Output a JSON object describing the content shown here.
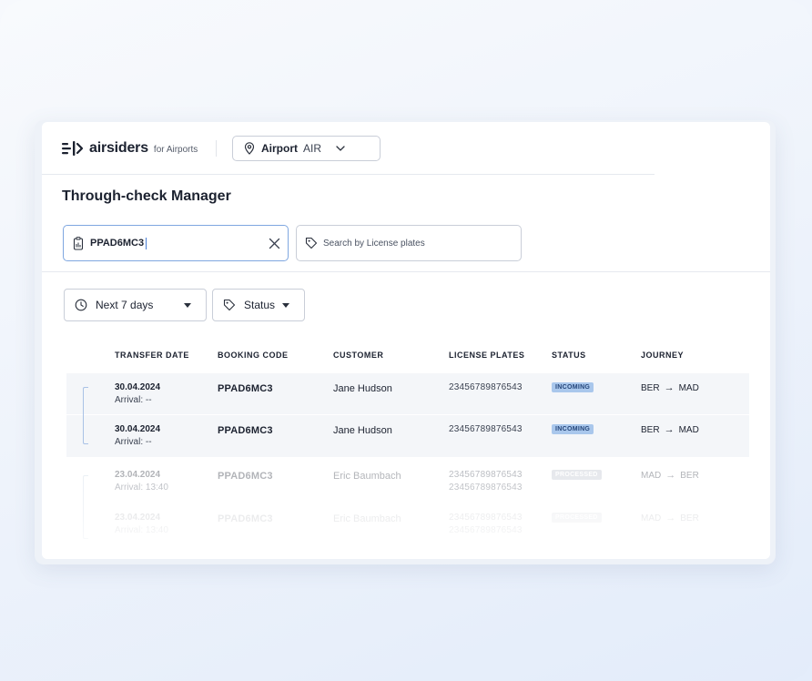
{
  "brand": {
    "name": "airsiders",
    "sub": "for Airports"
  },
  "airport_select": {
    "label": "Airport",
    "code": "AIR"
  },
  "page": {
    "title": "Through-check Manager"
  },
  "search": {
    "value": "PPAD6MC3",
    "plate_placeholder": "Search by License plates"
  },
  "filters": {
    "date": "Next 7 days",
    "status": "Status"
  },
  "table": {
    "headers": [
      "TRANSFER DATE",
      "BOOKING CODE",
      "CUSTOMER",
      "LICENSE PLATES",
      "STATUS",
      "JOURNEY"
    ],
    "rows": [
      {
        "date": "30.04.2024",
        "arrival": "Arrival: --",
        "code": "PPAD6MC3",
        "customer": "Jane Hudson",
        "plates": [
          "23456789876543"
        ],
        "status": "INCOMING",
        "from": "BER",
        "to": "MAD"
      },
      {
        "date": "30.04.2024",
        "arrival": "Arrival: --",
        "code": "PPAD6MC3",
        "customer": "Jane Hudson",
        "plates": [
          "23456789876543"
        ],
        "status": "INCOMING",
        "from": "BER",
        "to": "MAD"
      },
      {
        "date": "23.04.2024",
        "arrival": "Arrival: 13:40",
        "code": "PPAD6MC3",
        "customer": "Eric Baumbach",
        "plates": [
          "23456789876543",
          "23456789876543"
        ],
        "status": "PROCESSED",
        "from": "MAD",
        "to": "BER"
      },
      {
        "date": "23.04.2024",
        "arrival": "Arrival: 13:40",
        "code": "PPAD6MC3",
        "customer": "Eric Baumbach",
        "plates": [
          "23456789876543",
          "23456789876543"
        ],
        "status": "PROCESSED",
        "from": "MAD",
        "to": "BER"
      }
    ]
  },
  "colors": {
    "accent": "#7fa7e0",
    "badge_incoming": "#a9c7ec",
    "row_highlight": "#f4f6f9"
  }
}
